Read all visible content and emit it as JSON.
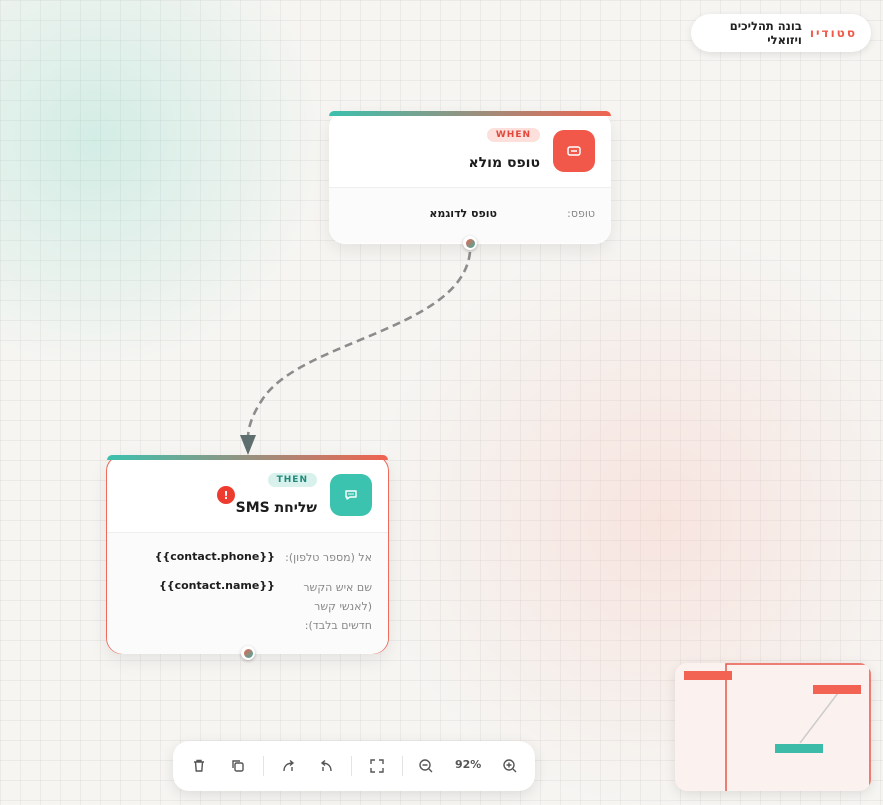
{
  "brand": {
    "name": "סטודיו",
    "subtitle": "בונה תהליכים ויזואלי"
  },
  "colors": {
    "accent_red": "#f06350",
    "accent_teal": "#3cc0ae",
    "error": "#ee3b2f"
  },
  "nodes": {
    "trigger": {
      "badge": "WHEN",
      "title": "טופס מולא",
      "icon": "form-icon",
      "fields": [
        {
          "label": "טופס:",
          "value": "טופס לדוגמא"
        }
      ]
    },
    "action": {
      "badge": "THEN",
      "title": "שליחת SMS",
      "icon": "message-icon",
      "error_icon": "!",
      "fields": [
        {
          "label": "אל (מספר טלפון):",
          "value": "{{contact.phone}}"
        },
        {
          "label_lines": [
            "שם איש הקשר",
            "(לאנשי קשר",
            "חדשים בלבד):"
          ],
          "value": "{{contact.name}}"
        }
      ]
    }
  },
  "toolbar": {
    "buttons": [
      "trash-icon",
      "duplicate-icon",
      "undo-icon",
      "redo-icon",
      "fit-view-icon",
      "zoom-out-icon",
      "zoom-in-icon"
    ],
    "zoom": "92%"
  },
  "minimap": {
    "label": "minimap"
  }
}
